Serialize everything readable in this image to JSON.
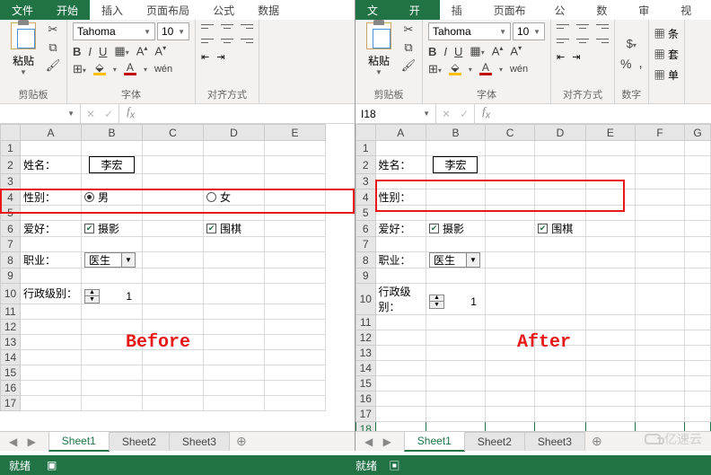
{
  "ribbon_tabs": {
    "file": "文件",
    "home": "开始",
    "insert": "插入",
    "layout": "页面布局",
    "formulas": "公式",
    "data": "数据",
    "review": "审阅",
    "view": "视图"
  },
  "ribbon": {
    "paste_label": "粘贴",
    "clipboard_group": "剪贴板",
    "font_group": "字体",
    "align_group": "对齐方式",
    "number_group": "数字",
    "font_name": "Tahoma",
    "font_size": "10",
    "bold": "B",
    "italic": "I",
    "underline": "U",
    "cond_fmt": "条",
    "table_fmt": "套",
    "cell_fmt": "单"
  },
  "before": {
    "name_box": "",
    "columns": [
      "A",
      "B",
      "C",
      "D",
      "E"
    ],
    "rows": [
      1,
      2,
      3,
      4,
      5,
      6,
      7,
      8,
      9,
      10,
      11,
      12,
      13,
      14,
      15,
      16,
      17
    ],
    "form": {
      "name_label": "姓名：",
      "name_value": "李宏",
      "gender_label": "性别：",
      "gender_male": "男",
      "gender_female": "女",
      "hobby_label": "爱好：",
      "hobby1": "摄影",
      "hobby2": "围棋",
      "job_label": "职业：",
      "job_value": "医生",
      "rank_label": "行政级别：",
      "rank_value": "1"
    },
    "big_label": "Before"
  },
  "after": {
    "name_box": "I18",
    "columns": [
      "A",
      "B",
      "C",
      "D",
      "E",
      "F",
      "G"
    ],
    "rows": [
      1,
      2,
      3,
      4,
      5,
      6,
      7,
      8,
      9,
      10,
      11,
      12,
      13,
      14,
      15,
      16,
      17,
      18
    ],
    "form": {
      "name_label": "姓名：",
      "name_value": "李宏",
      "gender_label": "性别：",
      "hobby_label": "爱好：",
      "hobby1": "摄影",
      "hobby2": "围棋",
      "job_label": "职业：",
      "job_value": "医生",
      "rank_label": "行政级别：",
      "rank_value": "1"
    },
    "big_label": "After"
  },
  "sheets": {
    "s1": "Sheet1",
    "s2": "Sheet2",
    "s3": "Sheet3"
  },
  "status": {
    "ready": "就绪"
  },
  "watermark": "亿速云"
}
